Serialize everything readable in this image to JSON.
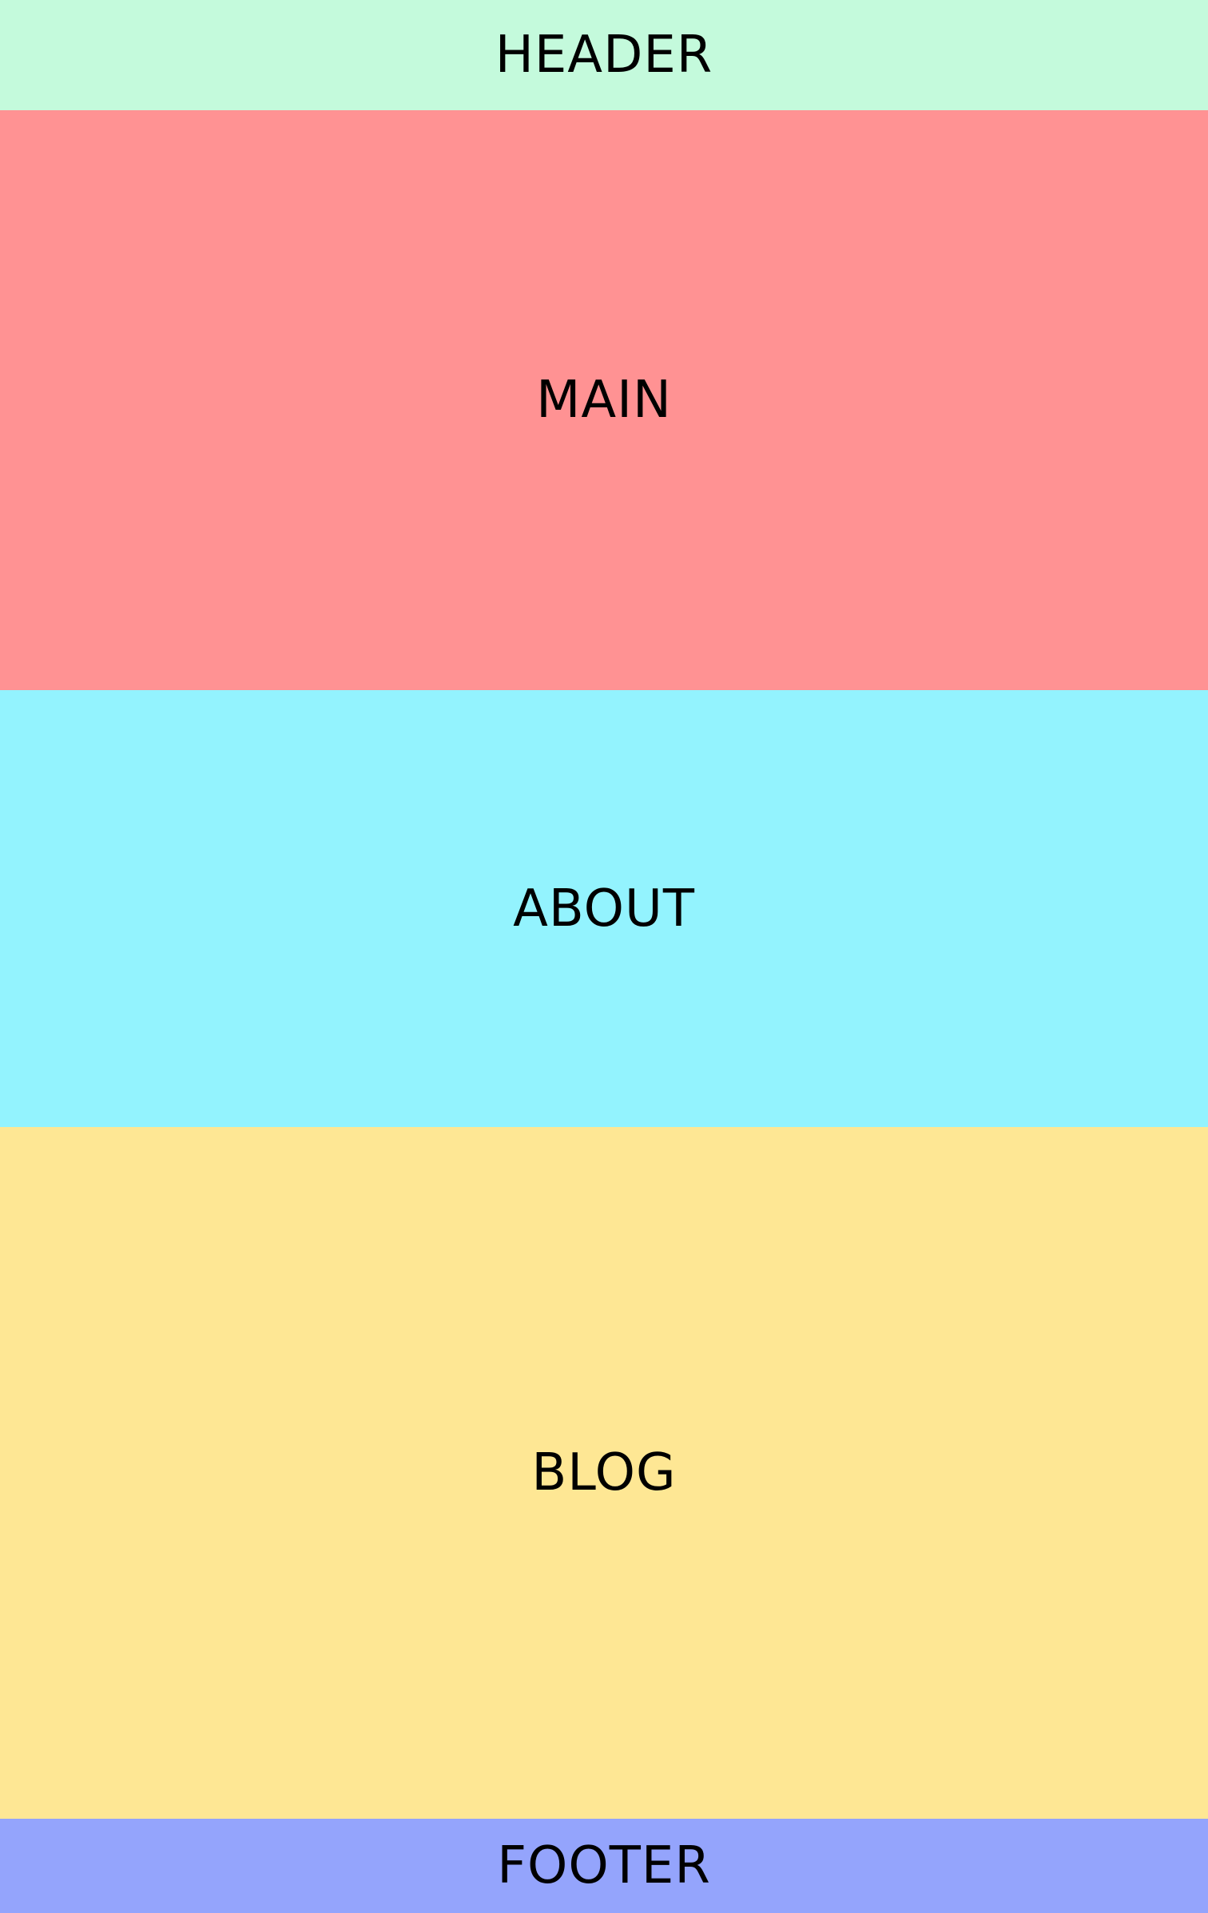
{
  "sections": {
    "header": {
      "label": "HEADER",
      "color": "#c4fadc"
    },
    "main": {
      "label": "MAIN",
      "color": "#ff9293"
    },
    "about": {
      "label": "ABOUT",
      "color": "#93f3fe"
    },
    "blog": {
      "label": "BLOG",
      "color": "#fee794"
    },
    "footer": {
      "label": "FOOTER",
      "color": "#94a4fc"
    }
  }
}
